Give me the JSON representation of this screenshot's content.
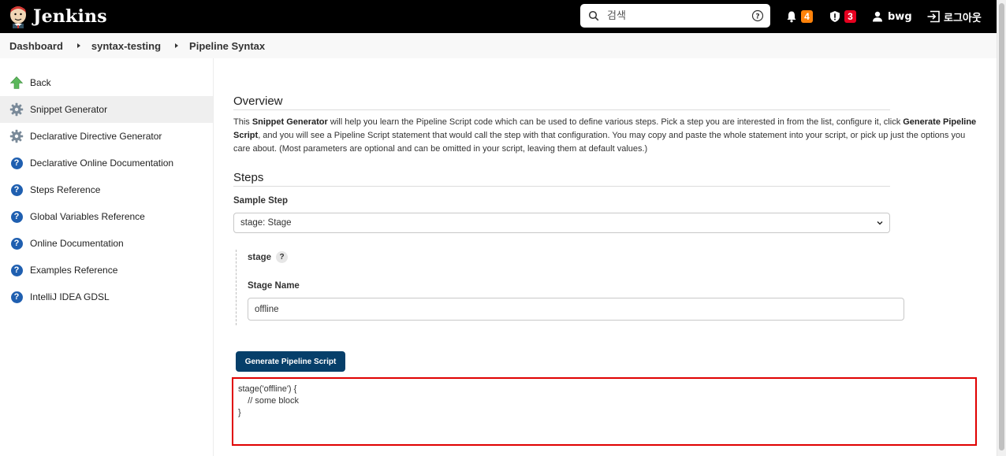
{
  "header": {
    "app_name": "Jenkins",
    "search_placeholder": "검색",
    "notifications_count": "4",
    "security_count": "3",
    "user_name": "bwg",
    "logout_label": "로그아웃",
    "colors": {
      "background": "#000000",
      "notification_badge": "#fe820a",
      "security_badge": "#e6001f"
    },
    "icons": [
      "jenkins-logo",
      "search-icon",
      "help-icon",
      "bell-icon",
      "shield-icon",
      "user-icon",
      "logout-icon"
    ]
  },
  "breadcrumb": {
    "items": [
      "Dashboard",
      "syntax-testing",
      "Pipeline Syntax"
    ]
  },
  "sidebar": {
    "items": [
      {
        "label": "Back",
        "icon": "up-arrow-icon",
        "active": false
      },
      {
        "label": "Snippet Generator",
        "icon": "gear-icon",
        "active": true
      },
      {
        "label": "Declarative Directive Generator",
        "icon": "gear-icon",
        "active": false
      },
      {
        "label": "Declarative Online Documentation",
        "icon": "help-circle-icon",
        "active": false
      },
      {
        "label": "Steps Reference",
        "icon": "help-circle-icon",
        "active": false
      },
      {
        "label": "Global Variables Reference",
        "icon": "help-circle-icon",
        "active": false
      },
      {
        "label": "Online Documentation",
        "icon": "help-circle-icon",
        "active": false
      },
      {
        "label": "Examples Reference",
        "icon": "help-circle-icon",
        "active": false
      },
      {
        "label": "IntelliJ IDEA GDSL",
        "icon": "help-circle-icon",
        "active": false
      }
    ]
  },
  "main": {
    "overview_title": "Overview",
    "overview_text": {
      "p1": "This ",
      "b1": "Snippet Generator",
      "p2": " will help you learn the Pipeline Script code which can be used to define various steps. Pick a step you are interested in from the list, configure it, click ",
      "b2": "Generate Pipeline Script",
      "p3": ", and you will see a Pipeline Script statement that would call the step with that configuration. You may copy and paste the whole statement into your script, or pick up just the options you care about. (Most parameters are optional and can be omitted in your script, leaving them at default values.)"
    },
    "steps_title": "Steps",
    "sample_step_label": "Sample Step",
    "sample_step_value": "stage: Stage",
    "step_name": "stage",
    "step_help": "?",
    "stage_name_label": "Stage Name",
    "stage_name_value": "offline",
    "generate_button_label": "Generate Pipeline Script",
    "generated_script": "stage('offline') {\n    // some block\n}",
    "colors": {
      "button": "#063f6a",
      "highlight_border": "#e00000"
    }
  }
}
